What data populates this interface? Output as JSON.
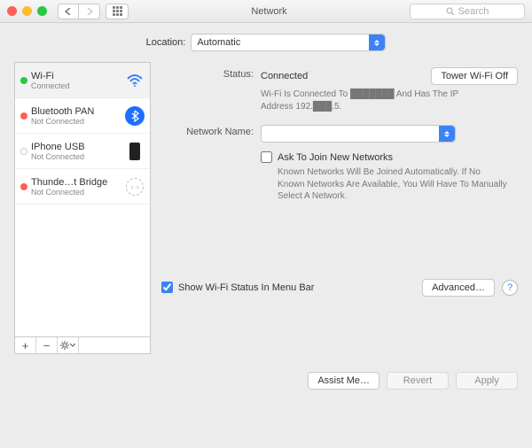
{
  "window": {
    "title": "Network"
  },
  "search": {
    "placeholder": "Search"
  },
  "location": {
    "label": "Location:",
    "value": "Automatic"
  },
  "sidebar": {
    "items": [
      {
        "name": "Wi-Fi",
        "sub": "Connected"
      },
      {
        "name": "Bluetooth PAN",
        "sub": "Not Connected"
      },
      {
        "name": "IPhone USB",
        "sub": "Not Connected"
      },
      {
        "name": "Thunde…t Bridge",
        "sub": "Not Connected"
      }
    ]
  },
  "details": {
    "status_label": "Status:",
    "status_value": "Connected",
    "wifi_toggle": "Tower Wi-Fi Off",
    "status_desc": "Wi-Fi Is Connected To ███████ And Has The IP Address 192.███.5.",
    "network_name_label": "Network Name:",
    "network_name_value": "",
    "ask_join": "Ask To Join New Networks",
    "ask_join_desc": "Known Networks Will Be Joined Automatically. If No Known Networks Are Available, You Will Have To Manually Select A Network.",
    "show_status": "Show Wi-Fi Status In Menu Bar",
    "advanced": "Advanced…"
  },
  "footer": {
    "assist": "Assist Me…",
    "revert": "Revert",
    "apply": "Apply"
  }
}
